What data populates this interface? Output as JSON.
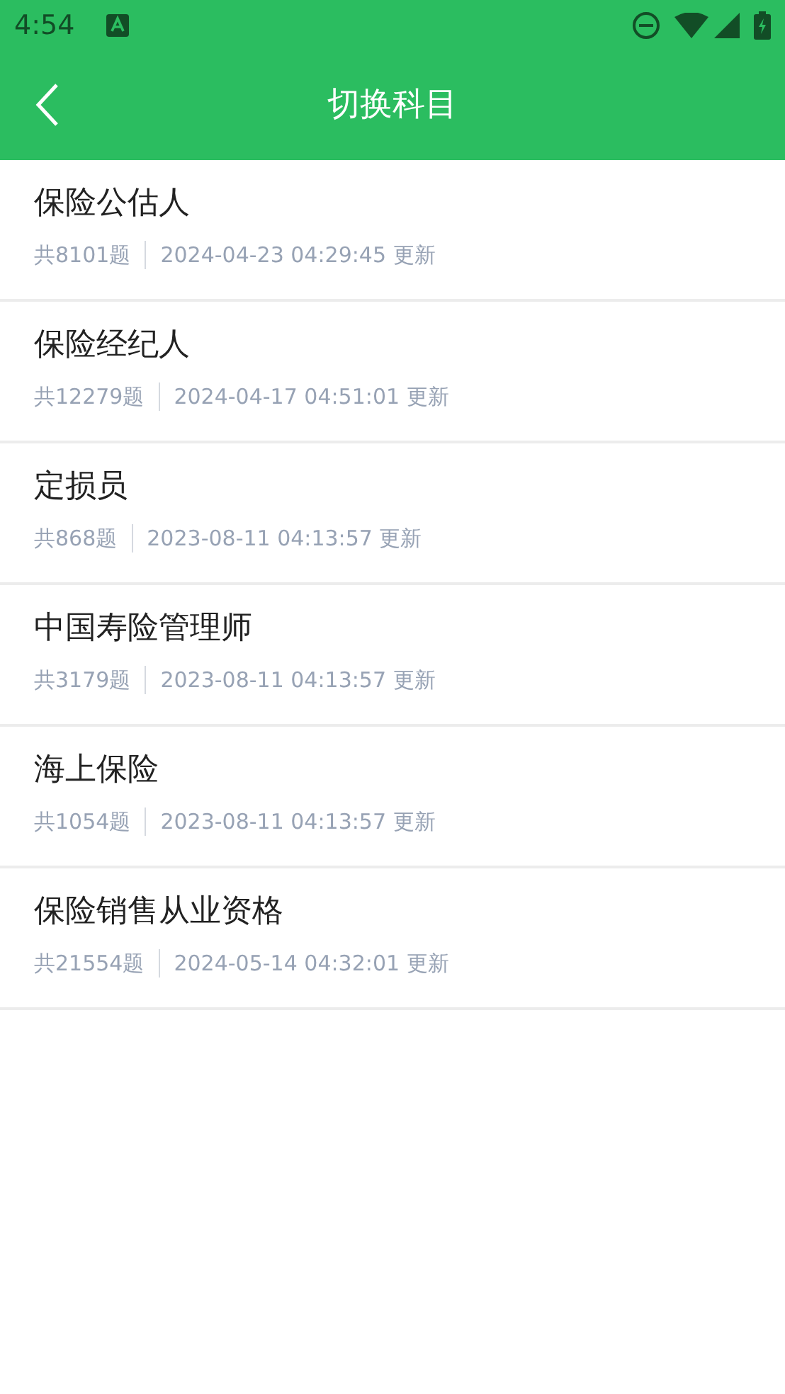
{
  "status_bar": {
    "time": "4:54"
  },
  "header": {
    "title": "切换科目"
  },
  "subjects": [
    {
      "name": "保险公估人",
      "count": "共8101题",
      "updated": "2024-04-23 04:29:45 更新"
    },
    {
      "name": "保险经纪人",
      "count": "共12279题",
      "updated": "2024-04-17 04:51:01 更新"
    },
    {
      "name": "定损员",
      "count": "共868题",
      "updated": "2023-08-11 04:13:57 更新"
    },
    {
      "name": "中国寿险管理师",
      "count": "共3179题",
      "updated": "2023-08-11 04:13:57 更新"
    },
    {
      "name": "海上保险",
      "count": "共1054题",
      "updated": "2023-08-11 04:13:57 更新"
    },
    {
      "name": "保险销售从业资格",
      "count": "共21554题",
      "updated": "2024-05-14 04:32:01 更新"
    }
  ]
}
